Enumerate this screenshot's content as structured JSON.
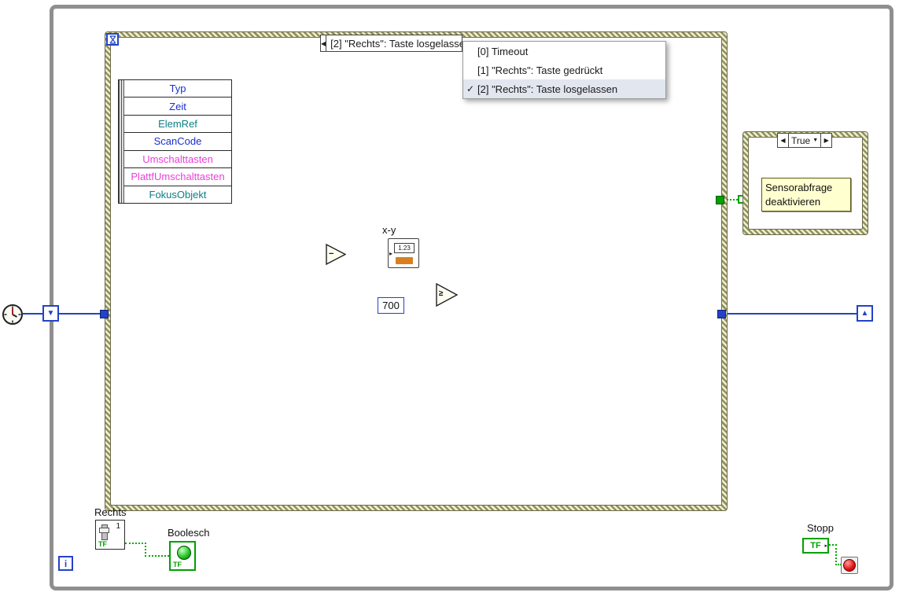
{
  "colors": {
    "wire_blue": "#2342c8",
    "wire_green": "#00a800",
    "boolean_green": "#00a000",
    "hatch_light": "#efefd2",
    "hatch_dark": "#90905e",
    "note_yellow": "#ffffd0",
    "type_tag_orange": "#d88020",
    "stop_red": "#e01010"
  },
  "loop": {
    "iteration_label": "i",
    "shift_register_down": "▼",
    "shift_register_up": "▲"
  },
  "event_structure": {
    "tab_prev_icon": "◀",
    "tab_label": "[2] \"Rechts\": Taste losgelassen"
  },
  "menu": {
    "items": [
      {
        "check": "",
        "label": "[0] Timeout",
        "selected": false
      },
      {
        "check": "",
        "label": "[1] \"Rechts\": Taste gedrückt",
        "selected": false
      },
      {
        "check": "✓",
        "label": "[2] \"Rechts\": Taste losgelassen",
        "selected": true
      }
    ]
  },
  "event_data_node": {
    "fields": [
      {
        "label": "Typ",
        "color": "#1a2ecb"
      },
      {
        "label": "Zeit",
        "color": "#1a2ecb"
      },
      {
        "label": "ElemRef",
        "color": "#0b7f86"
      },
      {
        "label": "ScanCode",
        "color": "#1a2ecb"
      },
      {
        "label": "Umschalttasten",
        "color": "#e93fd9"
      },
      {
        "label": "PlattfUmschalttasten",
        "color": "#e93fd9"
      },
      {
        "label": "FokusObjekt",
        "color": "#0b7f86"
      }
    ]
  },
  "nodes": {
    "subtract_glyph": "−",
    "xy_label": "x-y",
    "xy_value": "1.23",
    "constant_value": "700",
    "gte_glyph": "≥"
  },
  "case_structure": {
    "prev_icon": "◀",
    "selector": "True",
    "dropdown_icon": "▼",
    "next_icon": "▶",
    "note": "Sensorabfrage deaktivieren"
  },
  "controls": {
    "rechts_label": "Rechts",
    "rechts_digit": "1",
    "rechts_tf": "TF",
    "boolesch_label": "Boolesch",
    "boolesch_tf": "TF",
    "stopp_label": "Stopp",
    "stopp_tf": "TF"
  }
}
